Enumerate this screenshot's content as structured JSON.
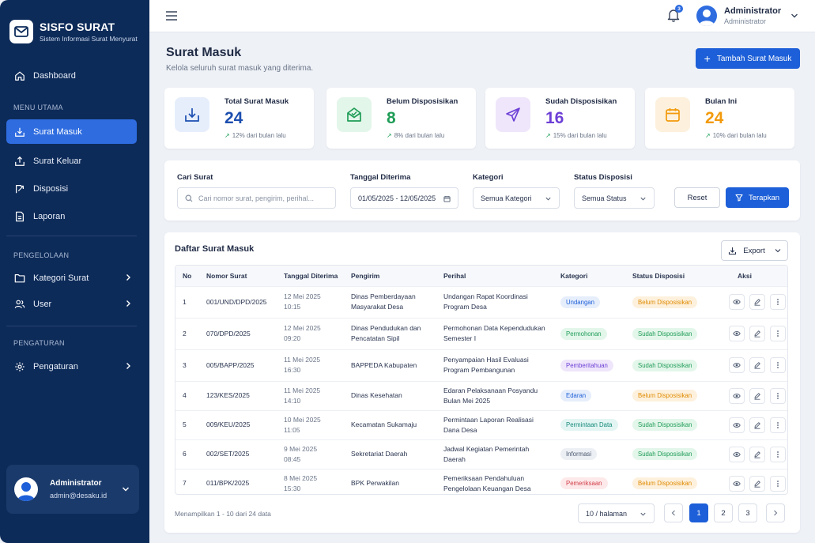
{
  "brand": {
    "title": "SISFO SURAT",
    "subtitle": "Sistem Informasi Surat Menyurat"
  },
  "sidebar": {
    "dashboard": "Dashboard",
    "section_main": "MENU UTAMA",
    "surat_masuk": "Surat Masuk",
    "surat_keluar": "Surat Keluar",
    "disposisi": "Disposisi",
    "laporan": "Laporan",
    "section_manage": "PENGELOLAAN",
    "kategori": "Kategori Surat",
    "user": "User",
    "section_settings": "PENGATURAN",
    "pengaturan": "Pengaturan",
    "user_card": {
      "name": "Administrator",
      "email": "admin@desaku.id"
    }
  },
  "topbar": {
    "notif_count": "3",
    "user_name": "Administrator",
    "user_role": "Administrator"
  },
  "page": {
    "title": "Surat Masuk",
    "subtitle": "Kelola seluruh surat masuk yang diterima.",
    "add_button": "Tambah Surat Masuk"
  },
  "stats": [
    {
      "label": "Total Surat Masuk",
      "value": "24",
      "trend": "12% dari bulan lalu",
      "color": "#1d4fb0",
      "icon": "inbox-download-icon"
    },
    {
      "label": "Belum Disposisikan",
      "value": "8",
      "trend": "8% dari bulan lalu",
      "color": "#1f9d57",
      "icon": "open-envelope-icon"
    },
    {
      "label": "Sudah Disposisikan",
      "value": "16",
      "trend": "15% dari bulan lalu",
      "color": "#6d3fd6",
      "icon": "paper-plane-icon"
    },
    {
      "label": "Bulan Ini",
      "value": "24",
      "trend": "10% dari bulan lalu",
      "color": "#f29a0c",
      "icon": "calendar-icon"
    }
  ],
  "filters": {
    "search_label": "Cari Surat",
    "search_placeholder": "Cari nomor surat, pengirim, perihal...",
    "date_label": "Tanggal Diterima",
    "date_value": "01/05/2025 - 12/05/2025",
    "category_label": "Kategori",
    "category_value": "Semua Kategori",
    "status_label": "Status Disposisi",
    "status_value": "Semua Status",
    "reset": "Reset",
    "apply": "Terapkan"
  },
  "table": {
    "title": "Daftar Surat Masuk",
    "export": "Export",
    "headers": {
      "no": "No",
      "nomor": "Nomor Surat",
      "tanggal": "Tanggal Diterima",
      "pengirim": "Pengirim",
      "perihal": "Perihal",
      "kategori": "Kategori",
      "status": "Status Disposisi",
      "aksi": "Aksi"
    },
    "rows": [
      {
        "no": "1",
        "nomor": "001/UND/DPD/2025",
        "date": "12 Mei 2025",
        "time": "10:15",
        "pengirim": [
          "Dinas Pemberdayaan",
          "Masyarakat Desa"
        ],
        "perihal": [
          "Undangan Rapat Koordinasi",
          "Program Desa"
        ],
        "kategori": "Undangan",
        "status": "Belum Disposisikan"
      },
      {
        "no": "2",
        "nomor": "070/DPD/2025",
        "date": "12 Mei 2025",
        "time": "09:20",
        "pengirim": [
          "Dinas Pendudukan dan",
          "Pencatatan Sipil"
        ],
        "perihal": [
          "Permohonan Data Kependudukan",
          "Semester I"
        ],
        "kategori": "Permohonan",
        "status": "Sudah Disposisikan"
      },
      {
        "no": "3",
        "nomor": "005/BAPP/2025",
        "date": "11 Mei 2025",
        "time": "16:30",
        "pengirim": [
          "BAPPEDA Kabupaten",
          ""
        ],
        "perihal": [
          "Penyampaian Hasil Evaluasi",
          "Program Pembangunan"
        ],
        "kategori": "Pemberitahuan",
        "status": "Sudah Disposisikan"
      },
      {
        "no": "4",
        "nomor": "123/KES/2025",
        "date": "11 Mei 2025",
        "time": "14:10",
        "pengirim": [
          "Dinas Kesehatan",
          ""
        ],
        "perihal": [
          "Edaran Pelaksanaan Posyandu",
          "Bulan Mei 2025"
        ],
        "kategori": "Edaran",
        "status": "Belum Disposisikan"
      },
      {
        "no": "5",
        "nomor": "009/KEU/2025",
        "date": "10 Mei 2025",
        "time": "11:05",
        "pengirim": [
          "Kecamatan Sukamaju",
          ""
        ],
        "perihal": [
          "Permintaan Laporan Realisasi",
          "Dana Desa"
        ],
        "kategori": "Permintaan Data",
        "status": "Sudah Disposisikan"
      },
      {
        "no": "6",
        "nomor": "002/SET/2025",
        "date": "9 Mei 2025",
        "time": "08:45",
        "pengirim": [
          "Sekretariat Daerah",
          ""
        ],
        "perihal": [
          "Jadwal Kegiatan Pemerintah",
          "Daerah"
        ],
        "kategori": "Informasi",
        "status": "Sudah Disposisikan"
      },
      {
        "no": "7",
        "nomor": "011/BPK/2025",
        "date": "8 Mei 2025",
        "time": "15:30",
        "pengirim": [
          "BPK Perwakilan",
          ""
        ],
        "perihal": [
          "Pemeriksaan Pendahuluan",
          "Pengelolaan Keuangan Desa"
        ],
        "kategori": "Pemeriksaan",
        "status": "Belum Disposisikan"
      }
    ]
  },
  "pagination": {
    "info": "Menampilkan 1 - 10 dari 24 data",
    "per_page": "10 / halaman",
    "pages": [
      "1",
      "2",
      "3"
    ],
    "current": "1"
  },
  "colors": {
    "sidebar_bg": "#0d2b59",
    "accent": "#1d5fd8",
    "category": {
      "Undangan": [
        "#e6eefc",
        "#1d5fd8"
      ],
      "Permohonan": [
        "#e3f6ea",
        "#1f9d57"
      ],
      "Pemberitahuan": [
        "#efe6fb",
        "#6d3fd6"
      ],
      "Edaran": [
        "#e6eefc",
        "#1d5fd8"
      ],
      "Permintaan Data": [
        "#e2f5f3",
        "#168a7a"
      ],
      "Informasi": [
        "#eceff4",
        "#4d5a70"
      ],
      "Pemeriksaan": [
        "#fde9ea",
        "#d2404a"
      ]
    },
    "status": {
      "Belum Disposisikan": [
        "#fdf1dd",
        "#e08a00"
      ],
      "Sudah Disposisikan": [
        "#e3f6ea",
        "#1f9d57"
      ]
    }
  }
}
